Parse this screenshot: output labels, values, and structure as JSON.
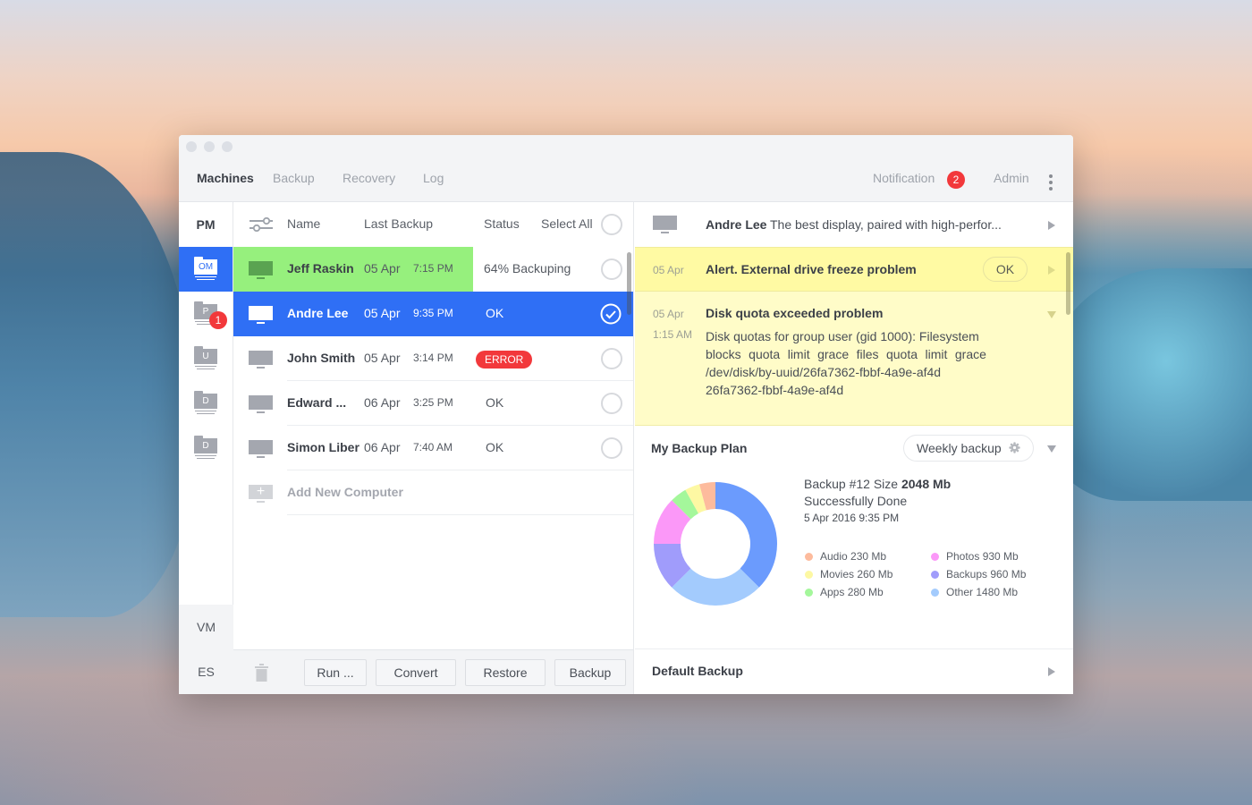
{
  "window": {
    "nav": {
      "tabs": [
        "Machines",
        "Backup",
        "Recovery",
        "Log"
      ],
      "active_tab": "Machines",
      "notification_label": "Notification",
      "notification_count": "2",
      "admin_label": "Admin"
    }
  },
  "sidebar": {
    "header": "PM",
    "items": [
      {
        "letter": "OM",
        "active": true,
        "badge": null
      },
      {
        "letter": "P",
        "active": false,
        "badge": "1"
      },
      {
        "letter": "U",
        "active": false,
        "badge": null
      },
      {
        "letter": "D",
        "active": false,
        "badge": null
      },
      {
        "letter": "D",
        "active": false,
        "badge": null
      }
    ],
    "bottom": [
      "VM",
      "ES"
    ]
  },
  "list": {
    "columns": {
      "name": "Name",
      "last_backup": "Last Backup",
      "status": "Status",
      "select_all": "Select All"
    },
    "rows": [
      {
        "name": "Jeff Raskin",
        "date": "05 Apr",
        "time": "7:15 PM",
        "status": "64% Backuping",
        "progress": 0.64,
        "state": "progress",
        "checked": false
      },
      {
        "name": "Andre Lee",
        "date": "05 Apr",
        "time": "9:35 PM",
        "status": "OK",
        "state": "selected",
        "checked": true
      },
      {
        "name": "John Smith",
        "date": "05 Apr",
        "time": "3:14 PM",
        "status": "ERROR",
        "state": "error",
        "checked": false
      },
      {
        "name": "Edward ...",
        "date": "06 Apr",
        "time": "3:25 PM",
        "status": "OK",
        "state": "normal",
        "checked": false
      },
      {
        "name": "Simon Liber",
        "date": "06 Apr",
        "time": "7:40 AM",
        "status": "OK",
        "state": "normal",
        "checked": false
      }
    ],
    "add_label": "Add New Computer"
  },
  "footer": {
    "buttons": [
      "Run ...",
      "Convert",
      "Restore",
      "Backup"
    ]
  },
  "detail": {
    "machine": {
      "name": "Andre Lee",
      "description": "The best display, paired with high-perfor..."
    },
    "alerts": [
      {
        "date": "05 Apr",
        "title": "Alert. External drive freeze problem",
        "action": "OK"
      },
      {
        "date": "05 Apr",
        "time": "1:15 AM",
        "title": "Disk quota exceeded problem",
        "body": [
          "Disk quotas for group user (gid 1000): Filesystem",
          [
            "blocks",
            "quota",
            "limit",
            "grace",
            "files",
            "quota",
            "limit",
            "grace"
          ],
          "/dev/disk/by-uuid/26fa7362-fbbf-4a9e-af4d",
          "26fa7362-fbbf-4a9e-af4d"
        ]
      }
    ],
    "plan": {
      "title": "My Backup Plan",
      "schedule": "Weekly backup",
      "summary_prefix": "Backup #12 Size",
      "summary_size": "2048 Mb",
      "summary_status": "Successfully Done",
      "summary_date": "5 Apr 2016 9:35 PM"
    },
    "default_backup": "Default Backup"
  },
  "colors": {
    "accent": "#2f6ff5",
    "progress": "#96f07d",
    "error": "#f2383b",
    "alert_bg": "#fffaa3",
    "alert_bg_light": "#fffcc8"
  },
  "chart_data": {
    "type": "pie",
    "title": "My Backup Plan",
    "donut": true,
    "segments": [
      {
        "name": "",
        "color": "#6b9bfd",
        "fraction": 0.375
      },
      {
        "name": "Other",
        "color": "#a3cbfd",
        "fraction": 0.25
      },
      {
        "name": "Backups",
        "color": "#a09cfb",
        "fraction": 0.125
      },
      {
        "name": "Photos",
        "color": "#fb98f8",
        "fraction": 0.125
      },
      {
        "name": "Apps",
        "color": "#a4f79b",
        "fraction": 0.044
      },
      {
        "name": "Movies",
        "color": "#fdf8a3",
        "fraction": 0.039
      },
      {
        "name": "Audio",
        "color": "#fdbb9d",
        "fraction": 0.042
      }
    ],
    "legend": [
      {
        "label": "Audio",
        "value": "230 Mb",
        "color": "#fdbb9d"
      },
      {
        "label": "Movies",
        "value": "260 Mb",
        "color": "#fdf8a3"
      },
      {
        "label": "Apps",
        "value": "280 Mb",
        "color": "#a4f79b"
      },
      {
        "label": "Photos",
        "value": "930 Mb",
        "color": "#fb98f8"
      },
      {
        "label": "Backups",
        "value": "960 Mb",
        "color": "#a09cfb"
      },
      {
        "label": "Other",
        "value": "1480 Mb",
        "color": "#a3cbfd"
      }
    ],
    "legend_position": "right"
  }
}
